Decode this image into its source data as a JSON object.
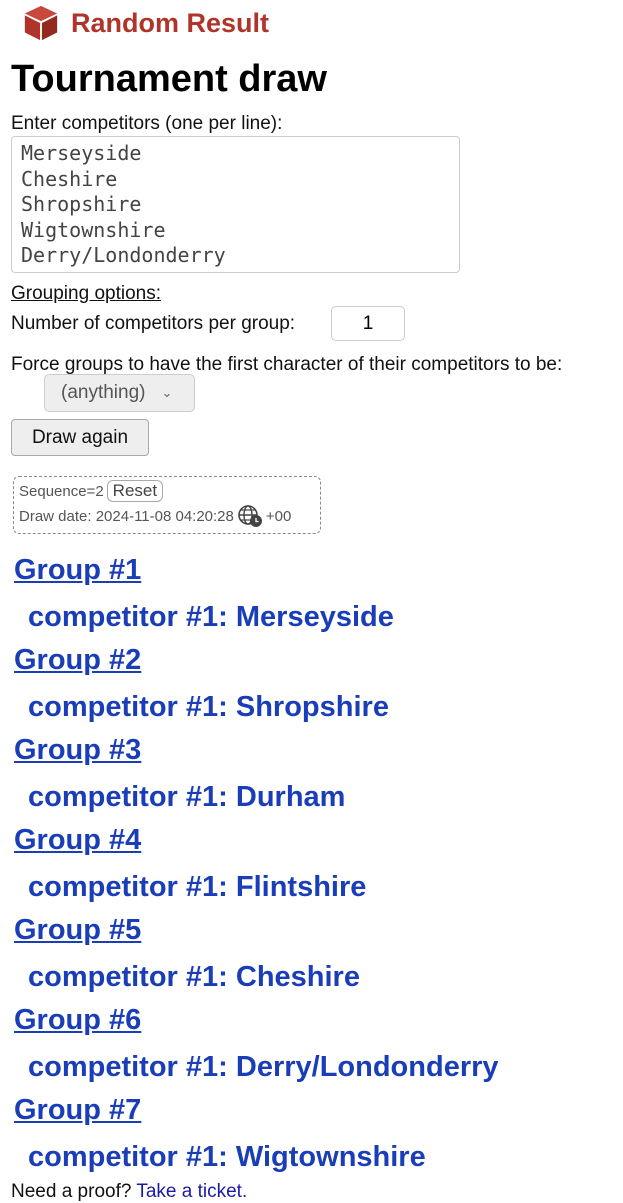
{
  "brand": {
    "name": "Random Result",
    "logo_icon": "cube-icon",
    "color": "#b0342a"
  },
  "title": "Tournament draw",
  "competitors_label": "Enter competitors (one per line):",
  "competitors_value": "Merseyside\nCheshire\nShropshire\nWigtownshire\nDerry/Londonderry\nFlintshire",
  "grouping_label": "Grouping options:",
  "per_group_label": "Number of competitors per group:",
  "per_group_value": "1",
  "force_label": "Force groups to have the first character of their competitors to be:",
  "force_select": "(anything)",
  "draw_again": "Draw again",
  "sequence": "Sequence=2",
  "reset": "Reset",
  "draw_date": "Draw date: 2024-11-08 04:20:28",
  "timezone": "+00",
  "groups": [
    {
      "title": "Group #1",
      "competitor": "competitor #1: Merseyside"
    },
    {
      "title": "Group #2",
      "competitor": "competitor #1: Shropshire"
    },
    {
      "title": "Group #3",
      "competitor": "competitor #1: Durham"
    },
    {
      "title": "Group #4",
      "competitor": "competitor #1: Flintshire"
    },
    {
      "title": "Group #5",
      "competitor": "competitor #1: Cheshire"
    },
    {
      "title": "Group #6",
      "competitor": "competitor #1: Derry/Londonderry"
    },
    {
      "title": "Group #7",
      "competitor": "competitor #1: Wigtownshire"
    }
  ],
  "footer": {
    "text": "Need a proof? ",
    "link": "Take a ticket."
  }
}
